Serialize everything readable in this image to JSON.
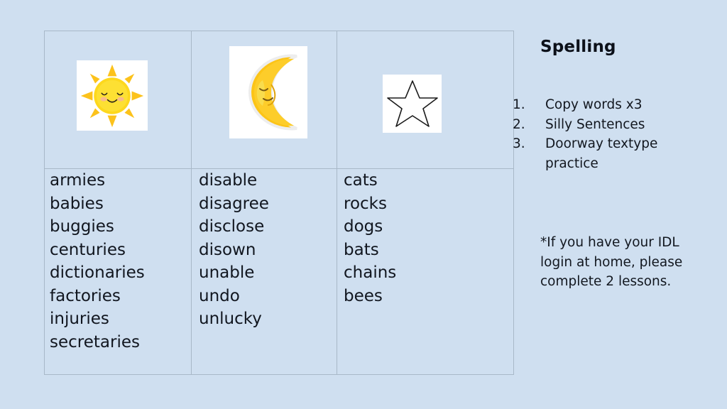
{
  "slide": {
    "background_color": "#cfdff0",
    "text_color": "#12171f",
    "table_border_color": "#a8b8c8"
  },
  "table": {
    "images": [
      {
        "name": "sun-image",
        "label": "smiling sun illustration"
      },
      {
        "name": "moon-image",
        "label": "sleeping crescent moon illustration"
      },
      {
        "name": "star-image",
        "label": "outlined five pointed star"
      }
    ],
    "columns": [
      {
        "id": "column-1",
        "words": [
          "armies",
          "babies",
          "buggies",
          "centuries",
          "dictionaries",
          "factories",
          "injuries",
          "secretaries"
        ]
      },
      {
        "id": "column-2",
        "words": [
          "disable",
          "disagree",
          "disclose",
          "disown",
          "unable",
          "undo",
          "unlucky"
        ]
      },
      {
        "id": "column-3",
        "words": [
          "cats",
          "rocks",
          "dogs",
          "bats",
          "chains",
          "bees"
        ]
      }
    ]
  },
  "panel": {
    "title": "Spelling",
    "tasks": [
      "Copy words x3",
      "Silly Sentences",
      "Doorway textype practice"
    ],
    "note": "*If you have your IDL login at home, please complete 2 lessons."
  }
}
